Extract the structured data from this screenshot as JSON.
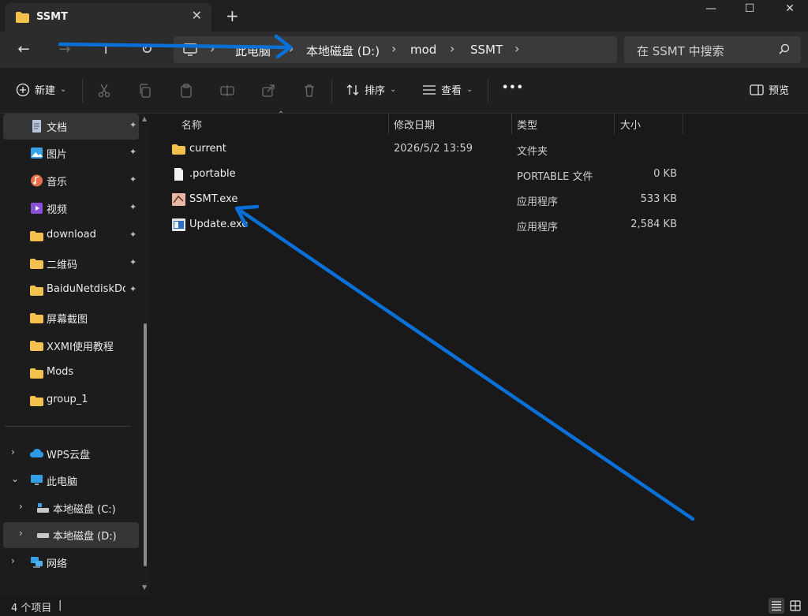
{
  "window": {
    "tab_title": "SSMT",
    "tab_close": "✕",
    "new_tab": "+",
    "controls": {
      "minimize": "—",
      "maximize": "☐",
      "close": "✕"
    }
  },
  "nav": {
    "back": "←",
    "forward": "→",
    "up": "↑",
    "refresh": "↻"
  },
  "breadcrumb": [
    {
      "label": "此电脑"
    },
    {
      "label": "本地磁盘 (D:)"
    },
    {
      "label": "mod"
    },
    {
      "label": "SSMT"
    }
  ],
  "search": {
    "placeholder": "在 SSMT 中搜索"
  },
  "toolbar": {
    "new_label": "新建",
    "sort_label": "排序",
    "view_label": "查看",
    "more_label": "•••",
    "preview_label": "预览"
  },
  "sidebar": {
    "quick_access": [
      {
        "label": "文档",
        "icon": "document-icon",
        "pinned": true,
        "selected": true
      },
      {
        "label": "图片",
        "icon": "pictures-icon",
        "pinned": true
      },
      {
        "label": "音乐",
        "icon": "music-icon",
        "pinned": true
      },
      {
        "label": "视频",
        "icon": "video-icon",
        "pinned": true
      },
      {
        "label": "download",
        "icon": "folder-icon",
        "pinned": true
      },
      {
        "label": "二维码",
        "icon": "folder-icon",
        "pinned": true
      },
      {
        "label": "BaiduNetdiskDownload",
        "icon": "folder-icon",
        "pinned": true
      },
      {
        "label": "屏幕截图",
        "icon": "folder-icon",
        "pinned": false
      },
      {
        "label": "XXMI使用教程",
        "icon": "folder-icon",
        "pinned": false
      },
      {
        "label": "Mods",
        "icon": "folder-icon",
        "pinned": false
      },
      {
        "label": "group_1",
        "icon": "folder-icon",
        "pinned": false
      }
    ],
    "tree": [
      {
        "label": "WPS云盘",
        "icon": "cloud-icon",
        "chevron": "›",
        "level": 0
      },
      {
        "label": "此电脑",
        "icon": "pc-icon",
        "chevron": "⌄",
        "level": 0
      },
      {
        "label": "本地磁盘 (C:)",
        "icon": "drive-icon",
        "chevron": "›",
        "level": 1
      },
      {
        "label": "本地磁盘 (D:)",
        "icon": "drive-icon",
        "chevron": "›",
        "level": 1,
        "selected": true
      },
      {
        "label": "网络",
        "icon": "network-icon",
        "chevron": "›",
        "level": 0
      }
    ],
    "pin_glyph": "📌"
  },
  "columns": {
    "name": "名称",
    "date": "修改日期",
    "type": "类型",
    "size": "大小"
  },
  "files": [
    {
      "name": "current",
      "date": "2026/5/2 13:59",
      "type": "文件夹",
      "size": "",
      "icon": "folder-icon"
    },
    {
      "name": ".portable",
      "date": "",
      "type": "PORTABLE 文件",
      "size": "0 KB",
      "icon": "file-icon"
    },
    {
      "name": "SSMT.exe",
      "date": "",
      "type": "应用程序",
      "size": "533 KB",
      "icon": "app-icon"
    },
    {
      "name": "Update.exe",
      "date": "",
      "type": "应用程序",
      "size": "2,584 KB",
      "icon": "app-icon"
    }
  ],
  "status": {
    "count": "4 个项目",
    "sep": "|"
  },
  "colors": {
    "accent": "#0a6fd6",
    "folder": "#f2c14e",
    "bg": "#191919"
  }
}
